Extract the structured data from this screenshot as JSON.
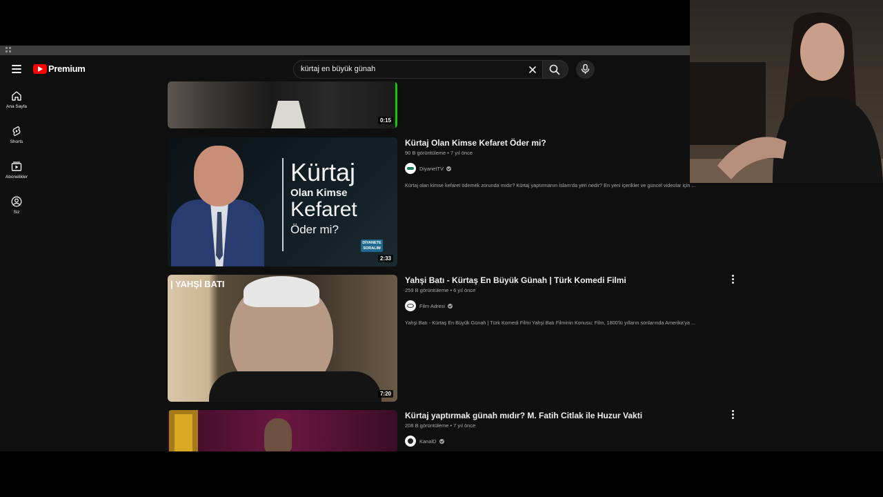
{
  "app": {
    "logo_text": "Premium"
  },
  "search": {
    "query": "kürtaj en büyük günah"
  },
  "guide": {
    "items": [
      {
        "label": "Ana Sayfa",
        "icon": "home-icon"
      },
      {
        "label": "Shorts",
        "icon": "shorts-icon"
      },
      {
        "label": "Abonelikler",
        "icon": "subscriptions-icon"
      },
      {
        "label": "Siz",
        "icon": "you-icon"
      }
    ]
  },
  "results": [
    {
      "duration": "0:15"
    },
    {
      "title": "Kürtaj Olan Kimse Kefaret Öder mi?",
      "stats": "90 B görüntüleme • 7 yıl önce",
      "channel": "DiyanetTV",
      "description": "Kürtaj olan kimse kefaret ödemek zorunda mıdır? Kürtaj yaptırmanın İslam'da yeri nedir? En yeni içerikler ve güncel videolar için ...",
      "duration": "2:33",
      "thumb_text": {
        "line1": "Kürtaj",
        "line2": "Olan Kimse",
        "line3": "Kefaret",
        "line4": "Öder mi?",
        "brand": "DİYANETE SORALIM"
      }
    },
    {
      "title": "Yahşi Batı - Kürtaş En Büyük Günah | Türk Komedi Filmi",
      "stats": "259 B görüntüleme • 6 yıl önce",
      "channel": "Film Adresi",
      "description": "Yahşi Batı - Kürtaş En Büyük Günah | Türk Komedi Filmi Yahşi Batı Filminin Konusu: Film, 1800'lü yılların sonlarında Amerika'ya ...",
      "duration": "7:20",
      "thumb_text": {
        "label": "| YAHŞİ BATI"
      }
    },
    {
      "title": "Kürtaj yaptırmak günah mıdır? M. Fatih Citlak ile Huzur Vakti",
      "stats": "208 B görüntüleme • 7 yıl önce",
      "channel": "KanalD"
    }
  ],
  "colors": {
    "accent": "#ff0000",
    "background": "#0f0f0f",
    "progress": "#16c60c"
  }
}
